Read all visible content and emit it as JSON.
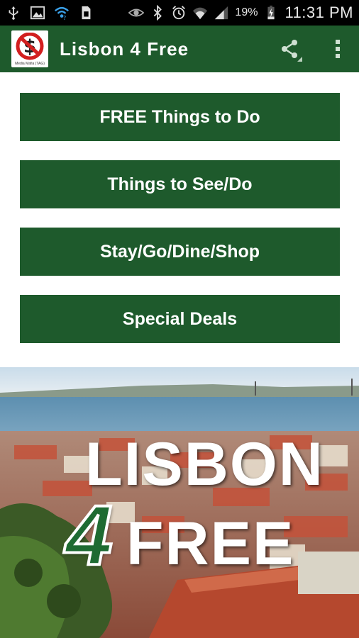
{
  "status_bar": {
    "battery_percent": "19%",
    "time": "11:31 PM",
    "icons": [
      "usb-icon",
      "image-icon",
      "wifi-notify-icon",
      "sim-icon",
      "eye-icon",
      "bluetooth-icon",
      "alarm-icon",
      "wifi-icon",
      "signal-icon",
      "battery-charging-icon"
    ]
  },
  "action_bar": {
    "title": "Lisbon 4 Free",
    "logo_caption": "Media Mafia (TAG)",
    "background": "#1e5a2c",
    "actions": [
      "share-icon",
      "overflow-menu-icon"
    ]
  },
  "menu": {
    "items": [
      {
        "label": "FREE Things to Do"
      },
      {
        "label": "Things to See/Do"
      },
      {
        "label": "Stay/Go/Dine/Shop"
      },
      {
        "label": "Special Deals"
      }
    ],
    "button_color": "#1e5a2c"
  },
  "banner": {
    "line1": "LISBON",
    "numeral": "4",
    "line2": "FREE"
  }
}
